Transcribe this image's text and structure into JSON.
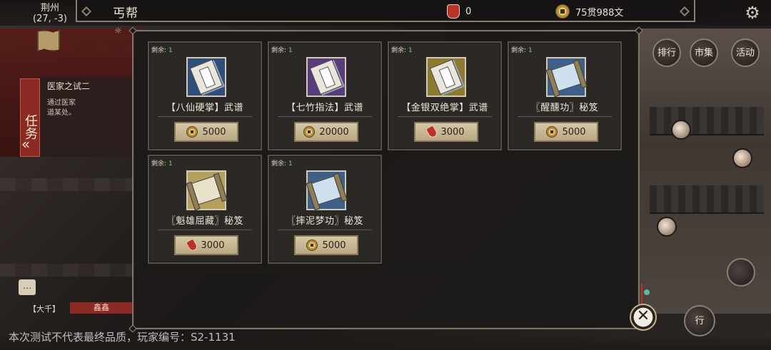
{
  "top": {
    "location_name": "荆州",
    "location_coords": "(27, -3)",
    "panel_title": "丐帮",
    "resource_bag": "0",
    "resource_money": "75贯988文"
  },
  "quest": {
    "tab_label": "任务",
    "title": "医家之试二",
    "desc_prefix": "通过医家",
    "desc_suffix": "道某处。"
  },
  "chat": {
    "channel": "【大千】",
    "name": "鑫鑫"
  },
  "watermark": "本次测试不代表最终品质，玩家编号：S2-1131",
  "stock_label": "剩余:",
  "items": [
    {
      "name": "【八仙硬掌】武谱",
      "stock": "1",
      "price": "5000",
      "currency": "coin",
      "icon": "book-blue"
    },
    {
      "name": "【七竹指法】武谱",
      "stock": "1",
      "price": "20000",
      "currency": "coin",
      "icon": "book-purple"
    },
    {
      "name": "【金银双绝掌】武谱",
      "stock": "1",
      "price": "3000",
      "currency": "bag",
      "icon": "book-gold"
    },
    {
      "name": "〖醒醺功〗秘笈",
      "stock": "1",
      "price": "5000",
      "currency": "coin",
      "icon": "scroll-blue"
    },
    {
      "name": "〖魁雄屈藏〗秘笈",
      "stock": "1",
      "price": "3000",
      "currency": "bag",
      "icon": "scroll-cream"
    },
    {
      "name": "〖摔泥梦功〗秘笈",
      "stock": "1",
      "price": "5000",
      "currency": "coin",
      "icon": "scroll-lightblue"
    }
  ],
  "side_buttons": {
    "rank": "排行",
    "market": "市集",
    "activity": "活动",
    "travel": "行"
  },
  "colors": {
    "accent_red": "#8b2a22",
    "stock_green": "#7fcf6c",
    "panel_border": "#7d7468"
  }
}
